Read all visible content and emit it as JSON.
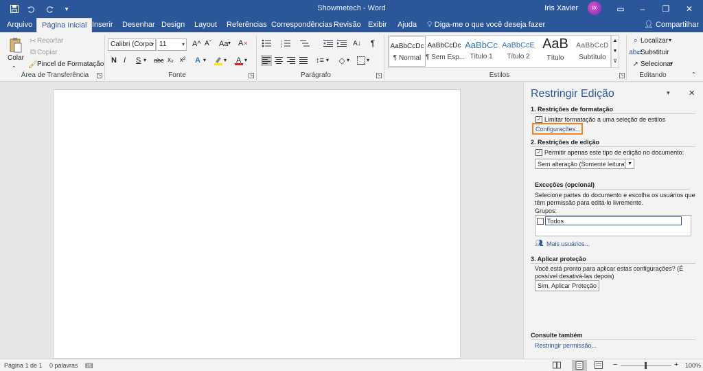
{
  "window": {
    "title": "Showmetech - Word",
    "user_name": "Iris Xavier",
    "avatar_text": "IX",
    "buttons": {
      "ribbon_display": "▭",
      "minimize": "–",
      "restore": "❐",
      "close": "✕"
    }
  },
  "qat": {
    "save_icon": "save-icon",
    "undo_icon": "undo-icon",
    "redo_icon": "redo-icon",
    "customize_icon": "customize-icon"
  },
  "tabs": [
    {
      "label": "Arquivo"
    },
    {
      "label": "Página Inicial"
    },
    {
      "label": "Inserir"
    },
    {
      "label": "Desenhar"
    },
    {
      "label": "Design"
    },
    {
      "label": "Layout"
    },
    {
      "label": "Referências"
    },
    {
      "label": "Correspondências"
    },
    {
      "label": "Revisão"
    },
    {
      "label": "Exibir"
    },
    {
      "label": "Ajuda"
    }
  ],
  "tell_me": "Diga-me o que você deseja fazer",
  "share": "Compartilhar",
  "ribbon": {
    "clipboard": {
      "paste": "Colar",
      "cut": "Recortar",
      "copy": "Copiar",
      "format_painter": "Pincel de Formatação",
      "label": "Área de Transferência"
    },
    "font": {
      "font_name": "Calibri (Corpo",
      "font_size": "11",
      "label": "Fonte",
      "bold": "N",
      "italic": "I",
      "underline": "S",
      "strike": "abc",
      "subscript": "x₂",
      "superscript": "x²",
      "grow": "A^",
      "shrink": "Aˇ",
      "case": "Aa",
      "clear": "A"
    },
    "paragraph": {
      "label": "Parágrafo"
    },
    "styles": {
      "label": "Estilos",
      "items": [
        {
          "preview": "AaBbCcDc",
          "name": "¶ Normal"
        },
        {
          "preview": "AaBbCcDc",
          "name": "¶ Sem Esp..."
        },
        {
          "preview": "AaBbCc",
          "name": "Título 1"
        },
        {
          "preview": "AaBbCcE",
          "name": "Título 2"
        },
        {
          "preview": "AaB",
          "name": "Título"
        },
        {
          "preview": "AaBbCcD",
          "name": "Subtítulo"
        }
      ]
    },
    "editing": {
      "find": "Localizar",
      "replace": "Substituir",
      "select": "Selecionar",
      "label": "Editando"
    }
  },
  "pane": {
    "title": "Restringir Edição",
    "s1_heading": "1. Restrições de formatação",
    "s1_checkbox": "Limitar formatação a uma seleção de estilos",
    "s1_link": "Configurações...",
    "s2_heading": "2. Restrições de edição",
    "s2_checkbox": "Permitir apenas este tipo de edição no documento:",
    "s2_select": "Sem alteração (Somente leitura)",
    "exceptions_heading": "Exceções (opcional)",
    "exceptions_text1": "Selecione partes do documento e escolha os usuários que",
    "exceptions_text2": "têm permissão para editá-lo livremente.",
    "groups_label": "Grupos:",
    "groups_item": "Todos",
    "more_users": "Mais usuários...",
    "s3_heading": "3. Aplicar proteção",
    "s3_text1": "Você está pronto para aplicar estas configurações? (É",
    "s3_text2": "possível desativá-las depois)",
    "s3_button": "Sim, Aplicar Proteção",
    "see_also_heading": "Consulte também",
    "see_also_link": "Restringir permissão..."
  },
  "status": {
    "page": "Página 1 de 1",
    "words": "0 palavras",
    "zoom": "100%",
    "zoom_minus": "−",
    "zoom_plus": "+"
  },
  "colors": {
    "accent": "#2b579a",
    "highlight_box": "#f5821f"
  }
}
